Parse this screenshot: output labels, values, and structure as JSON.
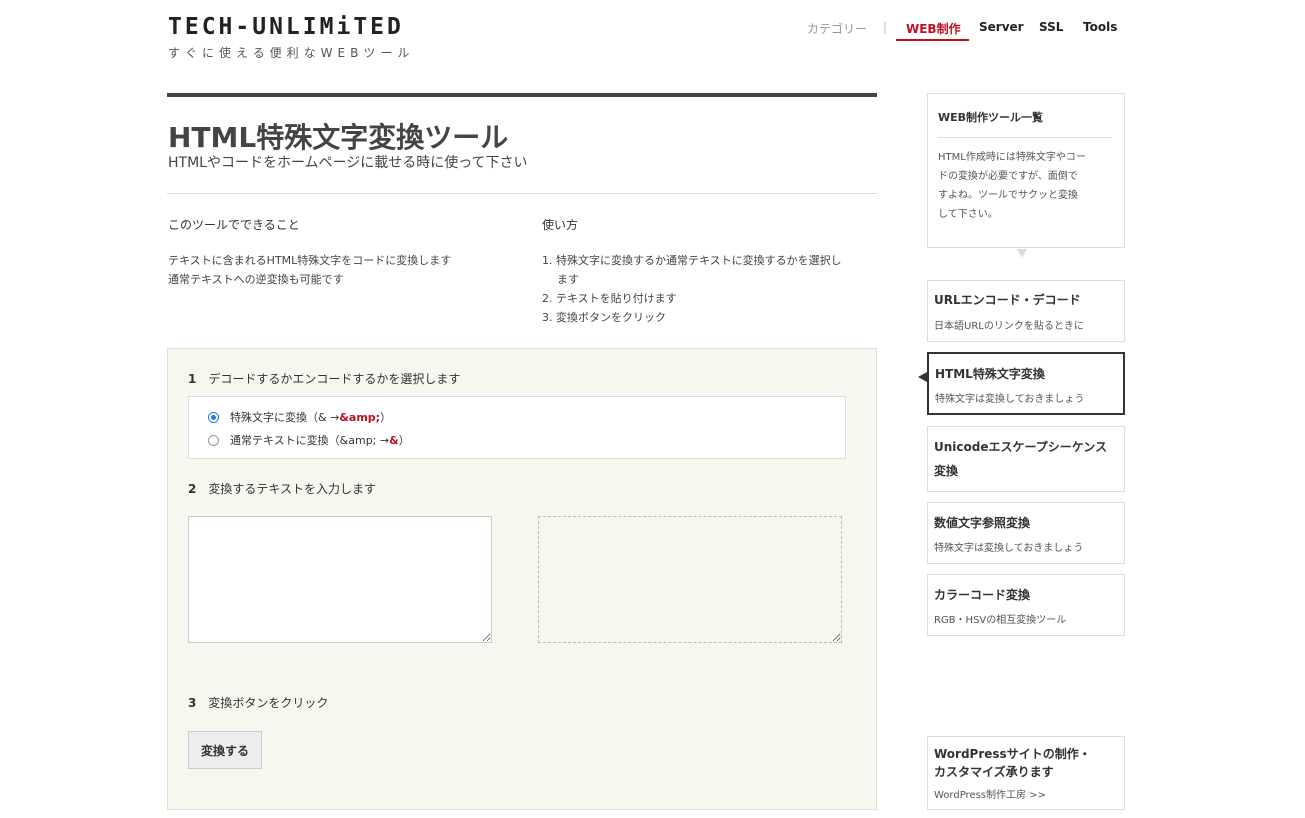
{
  "header": {
    "logo_title": "TECH-UNLIMiTED",
    "logo_subtitle": "すぐに使える便利なWEBツール",
    "nav": {
      "category_label": "カテゴリー",
      "separator": "|",
      "items": [
        "WEB制作",
        "Server",
        "SSL",
        "Tools"
      ],
      "active": "WEB制作"
    }
  },
  "main": {
    "title": "HTML特殊文字変換ツール",
    "lead": "HTMLやコードをホームページに載せる時に使って下さい",
    "features": {
      "heading": "このツールでできること",
      "lines": [
        "テキストに含まれるHTML特殊文字をコードに変換します",
        "通常テキストへの逆変換も可能です"
      ]
    },
    "howto": {
      "heading": "使い方",
      "steps": [
        "1. 特殊文字に変換するか通常テキストに変換するかを選択し",
        "ます",
        "2. テキストを貼り付けます",
        "3. 変換ボタンをクリック"
      ]
    }
  },
  "tool": {
    "step1": {
      "num": "1",
      "label": "デコードするかエンコードするかを選択します"
    },
    "options": [
      {
        "prefix": "特殊文字に変換（& → ",
        "highlight": "&amp;",
        "suffix": "）",
        "selected": true
      },
      {
        "prefix": "通常テキストに変換（&amp; → ",
        "highlight": "&",
        "suffix": "）",
        "selected": false
      }
    ],
    "step2": {
      "num": "2",
      "label": "変換するテキストを入力します"
    },
    "input_value": "",
    "output_value": "",
    "step3": {
      "num": "3",
      "label": "変換ボタンをクリック"
    },
    "convert_button": "変換する"
  },
  "sidebar": {
    "intro": {
      "title": "WEB制作ツール一覧",
      "lines": [
        "HTML作成時には特殊文字やコー",
        "ドの変換が必要ですが、面倒で",
        "すよね。ツールでサクッと変換",
        "して下さい。"
      ]
    },
    "tools": [
      {
        "title": "URLエンコード・デコード",
        "subtitle": "日本語URLのリンクを貼るときに"
      },
      {
        "title": "HTML特殊文字変換",
        "subtitle": "特殊文字は変換しておきましょう",
        "active": true
      },
      {
        "title_line1": "Unicodeエスケープシーケンス",
        "title_line2": "変換",
        "subtitle": ""
      },
      {
        "title": "数値文字参照変換",
        "subtitle": "特殊文字は変換しておきましょう"
      },
      {
        "title": "カラーコード変換",
        "subtitle": "RGB・HSVの相互変換ツール"
      }
    ],
    "promo": {
      "line1": "WordPressサイトの制作・",
      "line2": "カスタマイズ承ります",
      "link": "WordPress制作工房 >>"
    }
  },
  "colors": {
    "accent": "#c0101f",
    "dark_bar": "#44444c",
    "panel_bg": "#f7f6ef",
    "radio_blue": "#2a7be4"
  }
}
